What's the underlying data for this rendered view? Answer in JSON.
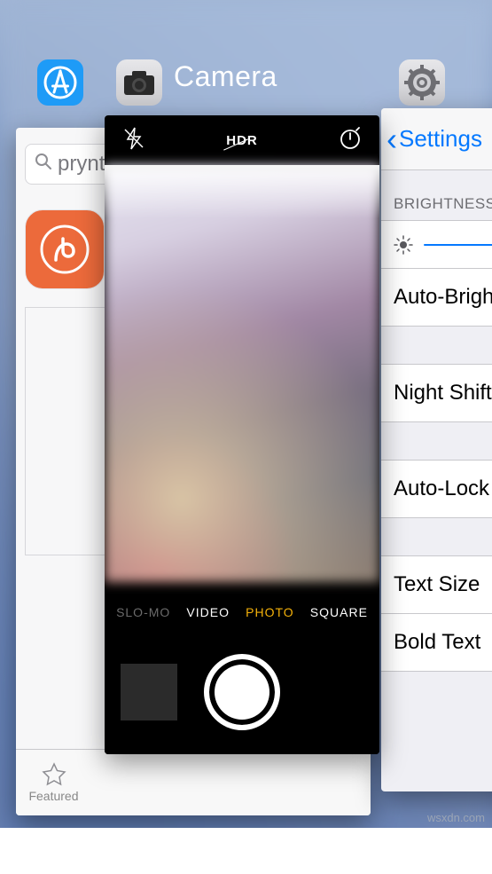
{
  "switcher": {
    "focused_app_title": "Camera"
  },
  "appstore": {
    "search_value": "prynt",
    "tabs": {
      "featured": "Featured"
    }
  },
  "camera": {
    "hdr_label": "HDR",
    "modes": {
      "slomo": "SLO-MO",
      "video": "VIDEO",
      "photo": "PHOTO",
      "square": "SQUARE"
    }
  },
  "settings": {
    "back_label": "Settings",
    "section_header": "BRIGHTNESS",
    "rows": {
      "auto_brightness": "Auto-Brightness",
      "night_shift": "Night Shift",
      "auto_lock": "Auto-Lock",
      "text_size": "Text Size",
      "bold_text": "Bold Text"
    }
  },
  "watermark": "wsxdn.com"
}
